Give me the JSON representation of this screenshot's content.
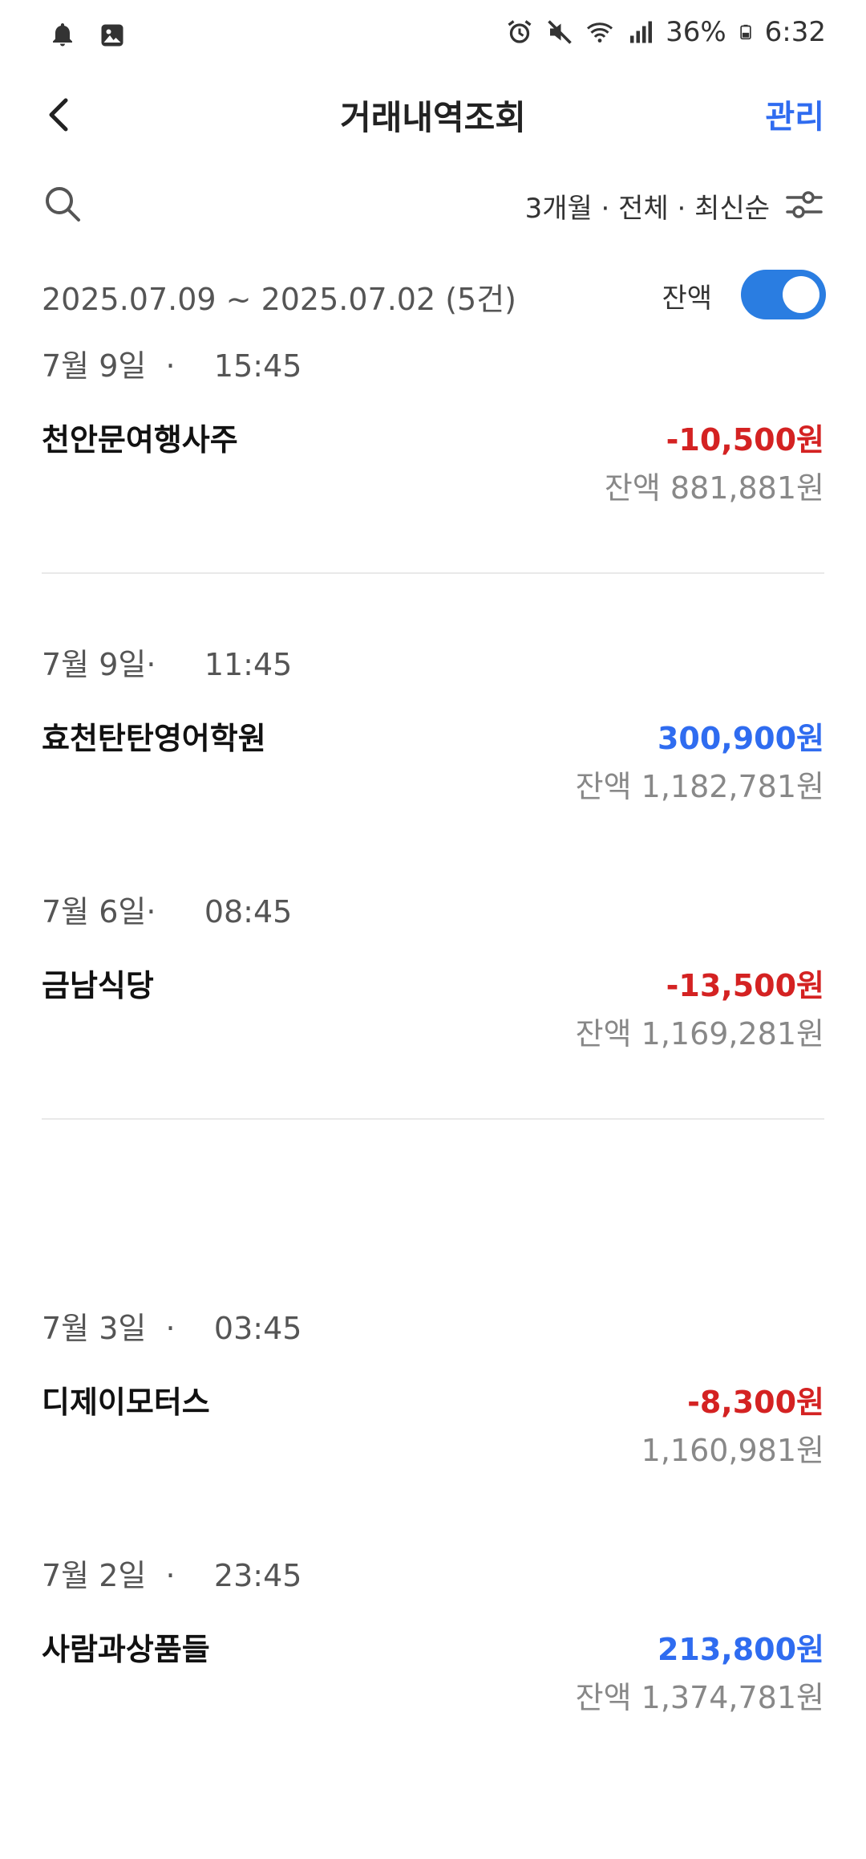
{
  "status_bar": {
    "battery": "36%",
    "time": "6:32"
  },
  "header": {
    "title": "거래내역조회",
    "manage_label": "관리"
  },
  "filter": {
    "text": "3개월 · 전체 · 최신순"
  },
  "range": {
    "text": "2025.07.09 ~ 2025.07.02 (5건)",
    "balance_label": "잔액",
    "balance_toggle_on": true
  },
  "transactions": [
    {
      "date": "7월 9일  ·    15:45",
      "merchant": "천안문여행사주",
      "amount": "-10,500원",
      "balance": "잔액 881,881원",
      "type": "withdrawal"
    },
    {
      "date": "7월 9일·     11:45",
      "merchant": "효천탄탄영어학원",
      "amount": "300,900원",
      "balance": "잔액 1,182,781원",
      "type": "deposit"
    },
    {
      "date": "7월 6일·     08:45",
      "merchant": "금남식당",
      "amount": "-13,500원",
      "balance": "잔액 1,169,281원",
      "type": "withdrawal"
    },
    {
      "date": "7월 3일  ·    03:45",
      "merchant": "디제이모터스",
      "amount": "-8,300원",
      "balance": "1,160,981원",
      "type": "withdrawal"
    },
    {
      "date": "7월 2일  ·    23:45",
      "merchant": "사람과상품들",
      "amount": "213,800원",
      "balance": "잔액 1,374,781원",
      "type": "deposit"
    }
  ],
  "colors": {
    "accent": "#2f6cf0",
    "negative": "#d42222",
    "toggle": "#2a7de1"
  }
}
